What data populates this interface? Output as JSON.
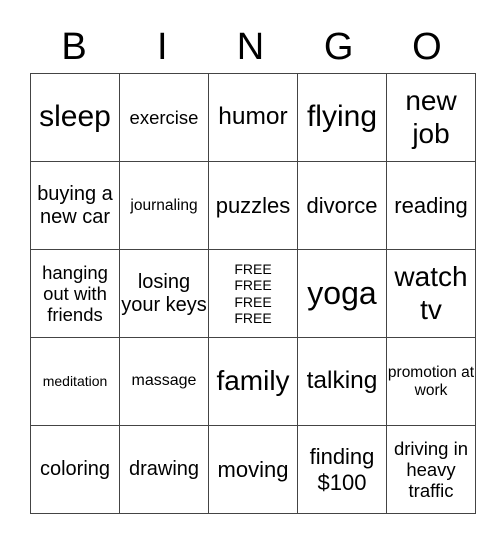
{
  "header": [
    "B",
    "I",
    "N",
    "G",
    "O"
  ],
  "grid": [
    [
      "sleep",
      "exercise",
      "humor",
      "flying",
      "new job"
    ],
    [
      "buying a new car",
      "journaling",
      "puzzles",
      "divorce",
      "reading"
    ],
    [
      "hanging out with friends",
      "losing your keys",
      "FREE FREE FREE FREE",
      "yoga",
      "watch tv"
    ],
    [
      "meditation",
      "massage",
      "family",
      "talking",
      "promotion at work"
    ],
    [
      "coloring",
      "drawing",
      "moving",
      "finding $100",
      "driving in heavy traffic"
    ]
  ]
}
